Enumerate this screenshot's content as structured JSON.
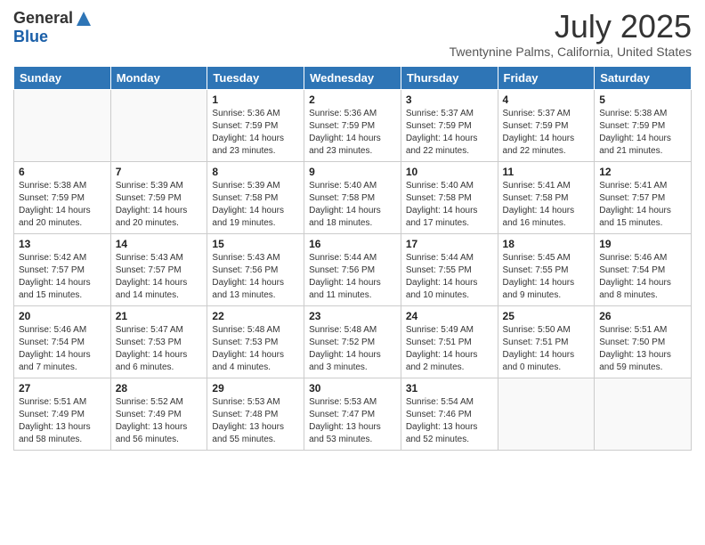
{
  "header": {
    "logo_general": "General",
    "logo_blue": "Blue",
    "month": "July 2025",
    "location": "Twentynine Palms, California, United States"
  },
  "days_of_week": [
    "Sunday",
    "Monday",
    "Tuesday",
    "Wednesday",
    "Thursday",
    "Friday",
    "Saturday"
  ],
  "weeks": [
    [
      {
        "day": "",
        "info": ""
      },
      {
        "day": "",
        "info": ""
      },
      {
        "day": "1",
        "info": "Sunrise: 5:36 AM\nSunset: 7:59 PM\nDaylight: 14 hours and 23 minutes."
      },
      {
        "day": "2",
        "info": "Sunrise: 5:36 AM\nSunset: 7:59 PM\nDaylight: 14 hours and 23 minutes."
      },
      {
        "day": "3",
        "info": "Sunrise: 5:37 AM\nSunset: 7:59 PM\nDaylight: 14 hours and 22 minutes."
      },
      {
        "day": "4",
        "info": "Sunrise: 5:37 AM\nSunset: 7:59 PM\nDaylight: 14 hours and 22 minutes."
      },
      {
        "day": "5",
        "info": "Sunrise: 5:38 AM\nSunset: 7:59 PM\nDaylight: 14 hours and 21 minutes."
      }
    ],
    [
      {
        "day": "6",
        "info": "Sunrise: 5:38 AM\nSunset: 7:59 PM\nDaylight: 14 hours and 20 minutes."
      },
      {
        "day": "7",
        "info": "Sunrise: 5:39 AM\nSunset: 7:59 PM\nDaylight: 14 hours and 20 minutes."
      },
      {
        "day": "8",
        "info": "Sunrise: 5:39 AM\nSunset: 7:58 PM\nDaylight: 14 hours and 19 minutes."
      },
      {
        "day": "9",
        "info": "Sunrise: 5:40 AM\nSunset: 7:58 PM\nDaylight: 14 hours and 18 minutes."
      },
      {
        "day": "10",
        "info": "Sunrise: 5:40 AM\nSunset: 7:58 PM\nDaylight: 14 hours and 17 minutes."
      },
      {
        "day": "11",
        "info": "Sunrise: 5:41 AM\nSunset: 7:58 PM\nDaylight: 14 hours and 16 minutes."
      },
      {
        "day": "12",
        "info": "Sunrise: 5:41 AM\nSunset: 7:57 PM\nDaylight: 14 hours and 15 minutes."
      }
    ],
    [
      {
        "day": "13",
        "info": "Sunrise: 5:42 AM\nSunset: 7:57 PM\nDaylight: 14 hours and 15 minutes."
      },
      {
        "day": "14",
        "info": "Sunrise: 5:43 AM\nSunset: 7:57 PM\nDaylight: 14 hours and 14 minutes."
      },
      {
        "day": "15",
        "info": "Sunrise: 5:43 AM\nSunset: 7:56 PM\nDaylight: 14 hours and 13 minutes."
      },
      {
        "day": "16",
        "info": "Sunrise: 5:44 AM\nSunset: 7:56 PM\nDaylight: 14 hours and 11 minutes."
      },
      {
        "day": "17",
        "info": "Sunrise: 5:44 AM\nSunset: 7:55 PM\nDaylight: 14 hours and 10 minutes."
      },
      {
        "day": "18",
        "info": "Sunrise: 5:45 AM\nSunset: 7:55 PM\nDaylight: 14 hours and 9 minutes."
      },
      {
        "day": "19",
        "info": "Sunrise: 5:46 AM\nSunset: 7:54 PM\nDaylight: 14 hours and 8 minutes."
      }
    ],
    [
      {
        "day": "20",
        "info": "Sunrise: 5:46 AM\nSunset: 7:54 PM\nDaylight: 14 hours and 7 minutes."
      },
      {
        "day": "21",
        "info": "Sunrise: 5:47 AM\nSunset: 7:53 PM\nDaylight: 14 hours and 6 minutes."
      },
      {
        "day": "22",
        "info": "Sunrise: 5:48 AM\nSunset: 7:53 PM\nDaylight: 14 hours and 4 minutes."
      },
      {
        "day": "23",
        "info": "Sunrise: 5:48 AM\nSunset: 7:52 PM\nDaylight: 14 hours and 3 minutes."
      },
      {
        "day": "24",
        "info": "Sunrise: 5:49 AM\nSunset: 7:51 PM\nDaylight: 14 hours and 2 minutes."
      },
      {
        "day": "25",
        "info": "Sunrise: 5:50 AM\nSunset: 7:51 PM\nDaylight: 14 hours and 0 minutes."
      },
      {
        "day": "26",
        "info": "Sunrise: 5:51 AM\nSunset: 7:50 PM\nDaylight: 13 hours and 59 minutes."
      }
    ],
    [
      {
        "day": "27",
        "info": "Sunrise: 5:51 AM\nSunset: 7:49 PM\nDaylight: 13 hours and 58 minutes."
      },
      {
        "day": "28",
        "info": "Sunrise: 5:52 AM\nSunset: 7:49 PM\nDaylight: 13 hours and 56 minutes."
      },
      {
        "day": "29",
        "info": "Sunrise: 5:53 AM\nSunset: 7:48 PM\nDaylight: 13 hours and 55 minutes."
      },
      {
        "day": "30",
        "info": "Sunrise: 5:53 AM\nSunset: 7:47 PM\nDaylight: 13 hours and 53 minutes."
      },
      {
        "day": "31",
        "info": "Sunrise: 5:54 AM\nSunset: 7:46 PM\nDaylight: 13 hours and 52 minutes."
      },
      {
        "day": "",
        "info": ""
      },
      {
        "day": "",
        "info": ""
      }
    ]
  ]
}
